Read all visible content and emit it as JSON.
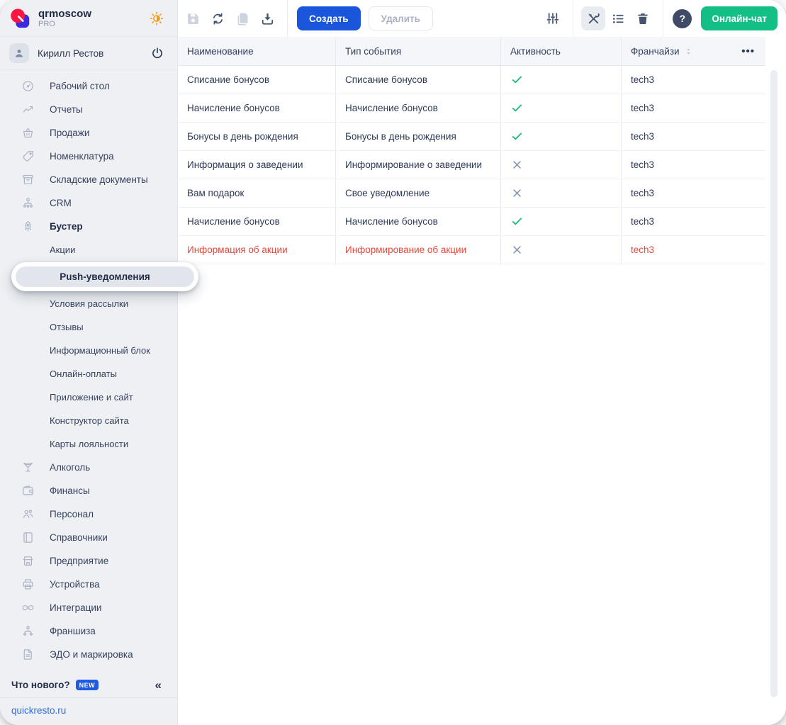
{
  "brand": {
    "name": "qrmoscow",
    "plan": "PRO"
  },
  "user": {
    "name": "Кирилл Рестов"
  },
  "toolbar": {
    "create_label": "Создать",
    "delete_label": "Удалить",
    "help_label": "?",
    "chat_label": "Онлайн-чат"
  },
  "sidebar": {
    "items": [
      {
        "label": "Рабочий стол",
        "icon": "dashboard-icon",
        "type": "item"
      },
      {
        "label": "Отчеты",
        "icon": "reports-icon",
        "type": "item"
      },
      {
        "label": "Продажи",
        "icon": "sales-icon",
        "type": "item"
      },
      {
        "label": "Номенклатура",
        "icon": "nomenclature-icon",
        "type": "item"
      },
      {
        "label": "Складские документы",
        "icon": "warehouse-icon",
        "type": "item"
      },
      {
        "label": "CRM",
        "icon": "crm-icon",
        "type": "item"
      },
      {
        "label": "Бустер",
        "icon": "booster-icon",
        "type": "item",
        "bold": true
      },
      {
        "label": "Акции",
        "type": "sub"
      },
      {
        "label": "Push-уведомления",
        "type": "sub",
        "active": true
      },
      {
        "label": "Условия рассылки",
        "type": "sub"
      },
      {
        "label": "Отзывы",
        "type": "sub"
      },
      {
        "label": "Информационный блок",
        "type": "sub"
      },
      {
        "label": "Онлайн-оплаты",
        "type": "sub"
      },
      {
        "label": "Приложение и сайт",
        "type": "sub"
      },
      {
        "label": "Конструктор сайта",
        "type": "sub"
      },
      {
        "label": "Карты лояльности",
        "type": "sub"
      },
      {
        "label": "Алкоголь",
        "icon": "alcohol-icon",
        "type": "item"
      },
      {
        "label": "Финансы",
        "icon": "finance-icon",
        "type": "item"
      },
      {
        "label": "Персонал",
        "icon": "staff-icon",
        "type": "item"
      },
      {
        "label": "Справочники",
        "icon": "directories-icon",
        "type": "item"
      },
      {
        "label": "Предприятие",
        "icon": "enterprise-icon",
        "type": "item"
      },
      {
        "label": "Устройства",
        "icon": "devices-icon",
        "type": "item"
      },
      {
        "label": "Интеграции",
        "icon": "integrations-icon",
        "type": "item"
      },
      {
        "label": "Франшиза",
        "icon": "franchise-icon",
        "type": "item"
      },
      {
        "label": "ЭДО и маркировка",
        "icon": "edo-icon",
        "type": "item"
      }
    ],
    "whats_new": {
      "label": "Что нового?",
      "badge": "NEW",
      "collapse_glyph": "«"
    },
    "site_link": "quickresto.ru"
  },
  "table": {
    "columns": [
      "Наименование",
      "Тип события",
      "Активность",
      "Франчайзи"
    ],
    "more_glyph": "•••",
    "rows": [
      {
        "name": "Списание бонусов",
        "event_type": "Списание бонусов",
        "active": true,
        "franchise": "tech3",
        "highlighted": false
      },
      {
        "name": "Начисление бонусов",
        "event_type": "Начисление бонусов",
        "active": true,
        "franchise": "tech3",
        "highlighted": false
      },
      {
        "name": "Бонусы в день рождения",
        "event_type": "Бонусы в день рождения",
        "active": true,
        "franchise": "tech3",
        "highlighted": false
      },
      {
        "name": "Информация о заведении",
        "event_type": "Информирование о заведении",
        "active": false,
        "franchise": "tech3",
        "highlighted": false
      },
      {
        "name": "Вам подарок",
        "event_type": "Свое уведомление",
        "active": false,
        "franchise": "tech3",
        "highlighted": false
      },
      {
        "name": "Начисление бонусов",
        "event_type": "Начисление бонусов",
        "active": true,
        "franchise": "tech3",
        "highlighted": false
      },
      {
        "name": "Информация об акции",
        "event_type": "Информирование об акции",
        "active": false,
        "franchise": "tech3",
        "highlighted": true
      }
    ]
  },
  "colors": {
    "accent_blue": "#1a56db",
    "chat_green": "#14bf85",
    "check_green": "#1eb978",
    "inactive_gray": "#8494ab",
    "alert_red": "#e8473a",
    "sidebar_bg": "#eef0f4",
    "badge_blue": "#1f5be0",
    "logo_red": "#fb1540",
    "logo_blue": "#3a2be0",
    "sun_orange": "#f59a18"
  },
  "icons": [
    "logo-icon",
    "sun-icon",
    "person-icon",
    "power-icon",
    "dashboard-icon",
    "reports-icon",
    "sales-icon",
    "nomenclature-icon",
    "warehouse-icon",
    "crm-icon",
    "booster-icon",
    "alcohol-icon",
    "finance-icon",
    "staff-icon",
    "directories-icon",
    "enterprise-icon",
    "devices-icon",
    "integrations-icon",
    "franchise-icon",
    "edo-icon",
    "save-icon",
    "refresh-icon",
    "copy-icon",
    "download-icon",
    "filter-sliders-icon",
    "tools-icon",
    "list-icon",
    "trash-icon",
    "help-icon",
    "sort-icon",
    "ellipsis-icon",
    "check-icon",
    "x-icon",
    "chevron-double-left-icon"
  ]
}
